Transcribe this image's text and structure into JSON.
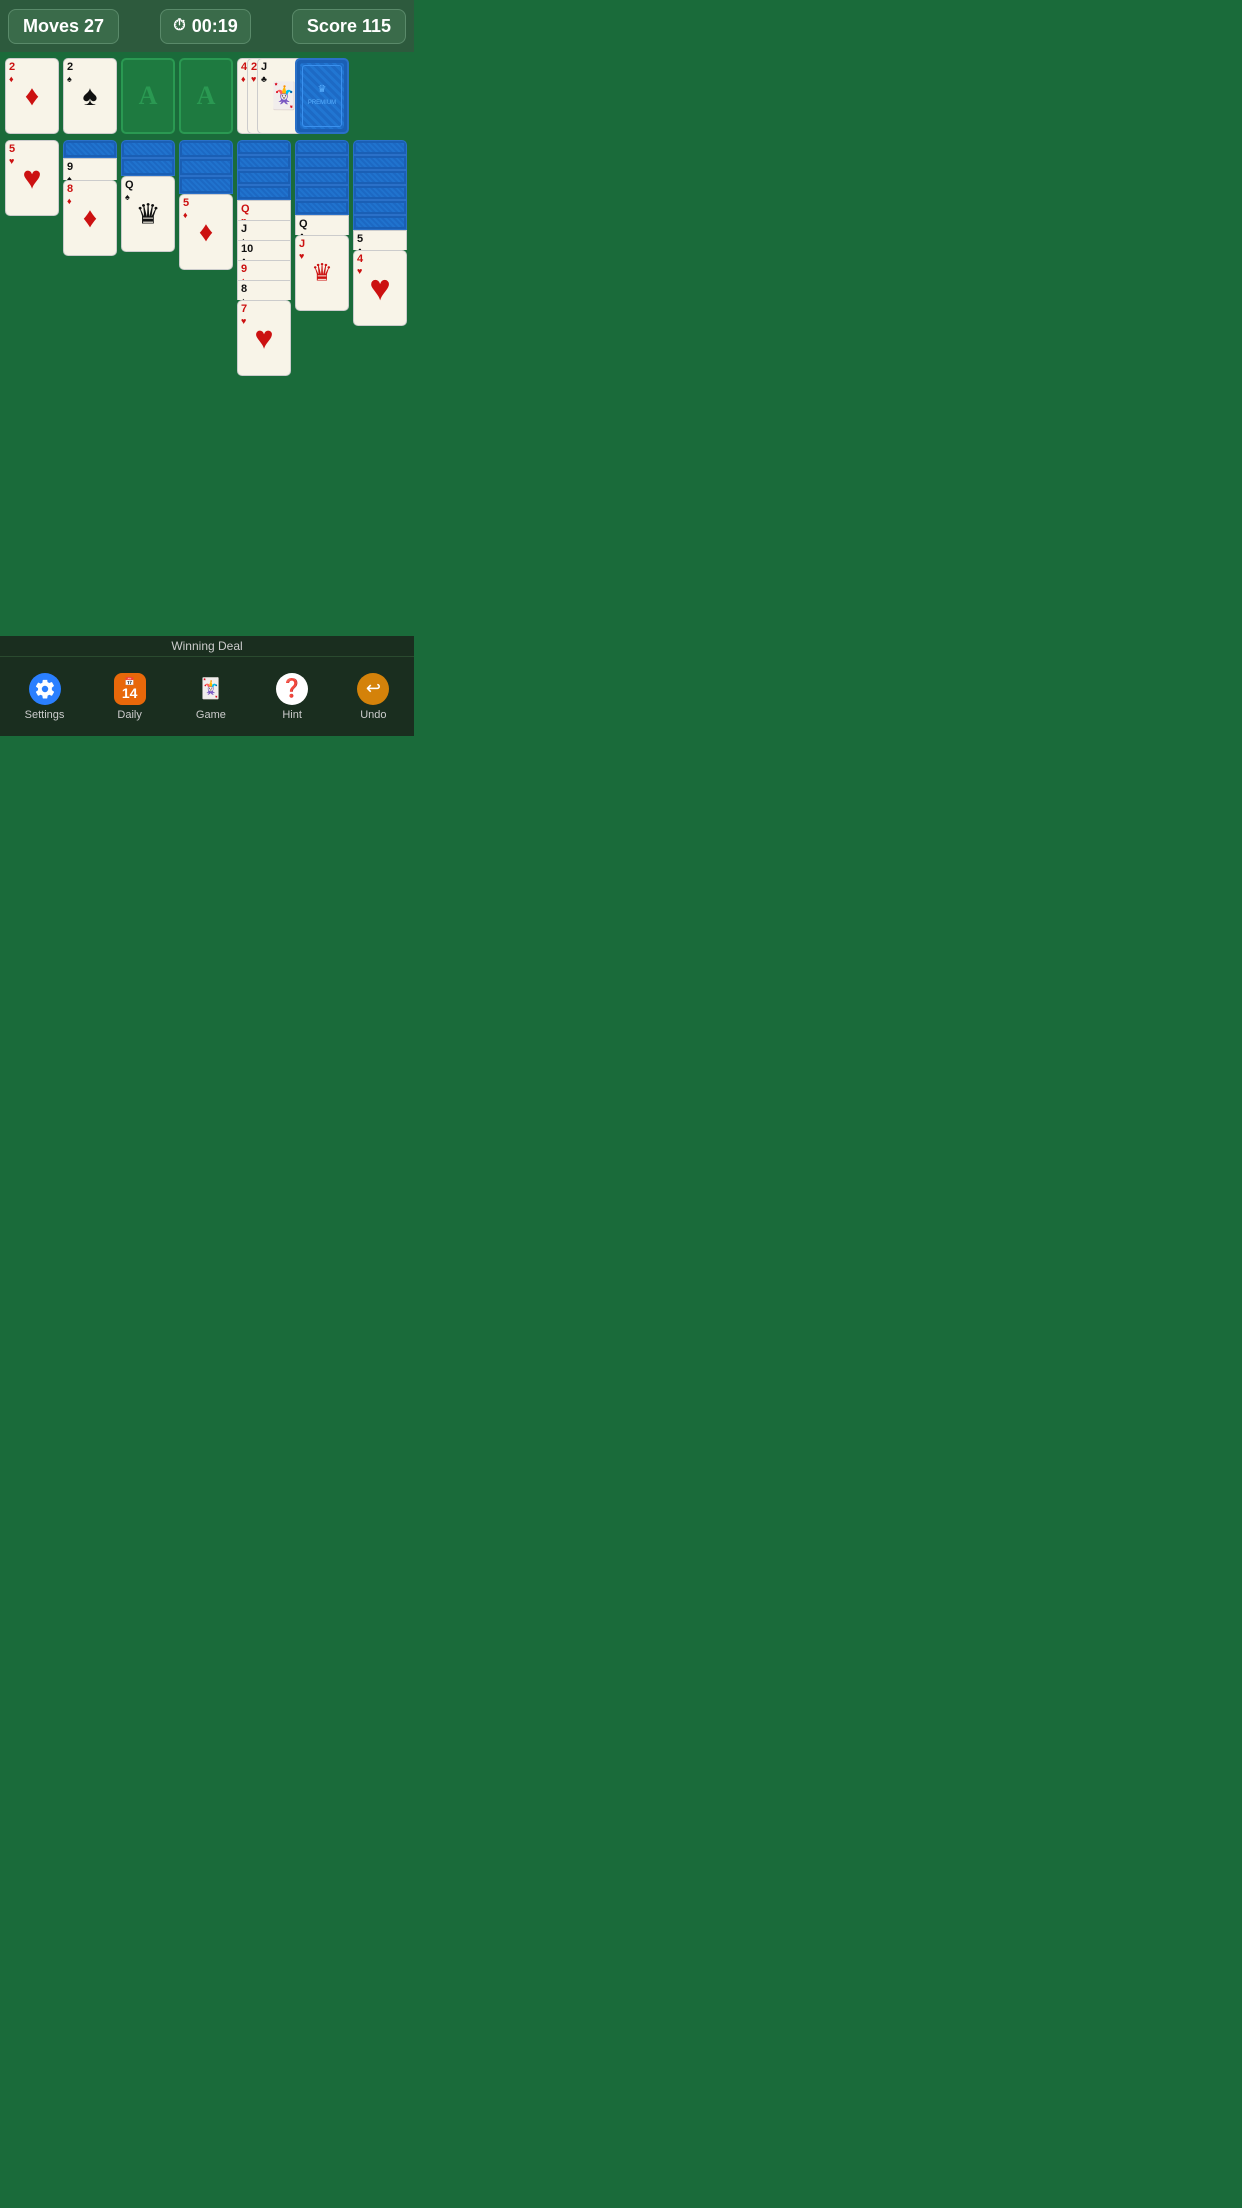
{
  "header": {
    "moves_label": "Moves 27",
    "timer_label": "00:19",
    "score_label": "Score 115",
    "timer_icon": "⏱"
  },
  "foundations": [
    {
      "suit": "♦",
      "rank": "2",
      "color": "red",
      "filled": true
    },
    {
      "suit": "♠",
      "rank": "2",
      "color": "black",
      "filled": true
    },
    {
      "suit": "A",
      "filled": false
    },
    {
      "suit": "A",
      "filled": false
    }
  ],
  "top_row_right": [
    {
      "suit": "♦",
      "rank": "4",
      "color": "red"
    },
    {
      "suit": "♥",
      "rank": "2",
      "color": "red"
    },
    {
      "suit": "♣",
      "rank": "J",
      "color": "black"
    }
  ],
  "stock": {
    "has_card": true
  },
  "tableau": {
    "col1": {
      "face_down": 0,
      "face_up": [
        {
          "rank": "5",
          "suit": "♥",
          "color": "red"
        }
      ]
    },
    "col2": {
      "face_down": 1,
      "face_up": [
        {
          "rank": "9",
          "suit": "♠",
          "color": "black"
        },
        {
          "rank": "8",
          "suit": "♦",
          "color": "red"
        }
      ]
    },
    "col3": {
      "face_down": 2,
      "face_up": [
        {
          "rank": "Q",
          "suit": "♠",
          "color": "black"
        }
      ]
    },
    "col4": {
      "face_down": 3,
      "face_up": [
        {
          "rank": "5",
          "suit": "♦",
          "color": "red"
        }
      ]
    },
    "col5": {
      "face_down": 4,
      "face_up": [
        {
          "rank": "Q",
          "suit": "♥",
          "color": "red"
        },
        {
          "rank": "J",
          "suit": "♠",
          "color": "black"
        },
        {
          "rank": "10",
          "suit": "♣",
          "color": "black"
        },
        {
          "rank": "9",
          "suit": "♦",
          "color": "red"
        },
        {
          "rank": "8",
          "suit": "♠",
          "color": "black"
        },
        {
          "rank": "7",
          "suit": "♥",
          "color": "red"
        }
      ]
    },
    "col6": {
      "face_down": 5,
      "face_up": [
        {
          "rank": "Q",
          "suit": "♣",
          "color": "black"
        },
        {
          "rank": "J",
          "suit": "♥",
          "color": "red"
        }
      ]
    },
    "col7": {
      "face_down": 6,
      "face_up": [
        {
          "rank": "5",
          "suit": "♣",
          "color": "black"
        },
        {
          "rank": "4",
          "suit": "♥",
          "color": "red"
        }
      ]
    }
  },
  "nav": {
    "settings_label": "Settings",
    "daily_label": "Daily",
    "daily_date": "14",
    "game_label": "Game",
    "hint_label": "Hint",
    "undo_label": "Undo"
  },
  "winning_deal": "Winning Deal"
}
